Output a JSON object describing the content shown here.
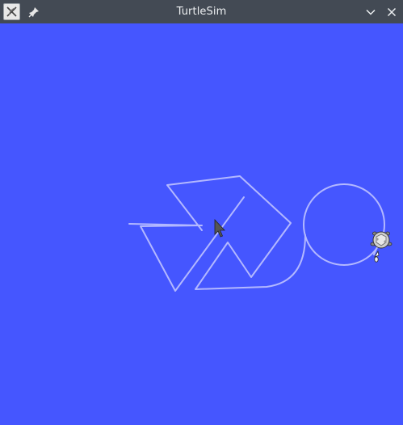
{
  "window": {
    "title": "TurtleSim",
    "background_color": "#4556ff",
    "titlebar_color": "#434a54",
    "pen_color": "#b3b8ff"
  },
  "titlebar": {
    "app_icon": "turtlesim-app-icon",
    "pin_icon": "pin-icon",
    "minimize_icon": "chevron-down-icon",
    "close_icon": "close-icon"
  },
  "canvas": {
    "turtle_icon": "turtle-icon",
    "cursor_icon": "mouse-pointer-icon"
  }
}
